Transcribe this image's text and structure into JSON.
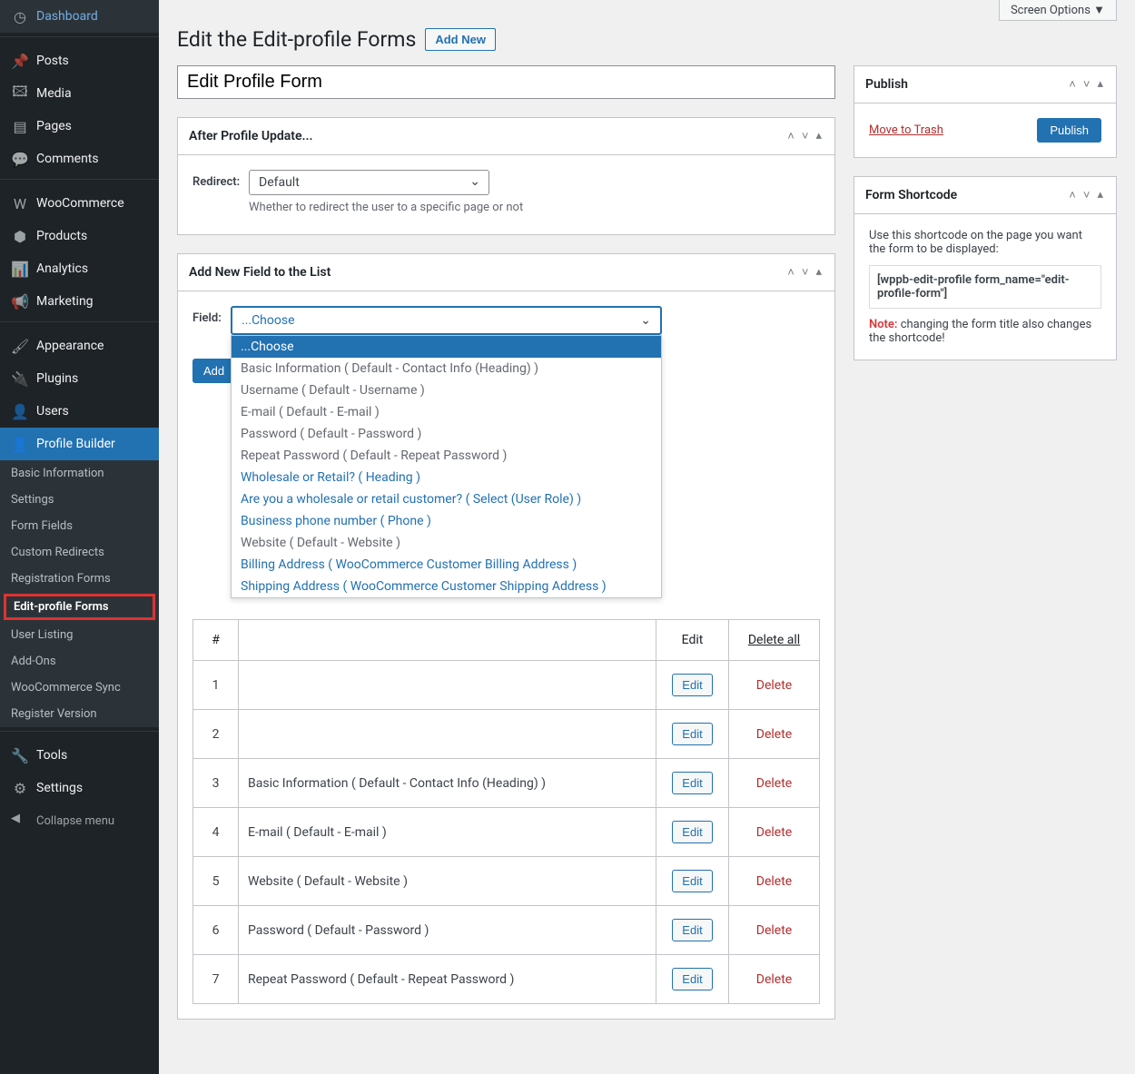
{
  "screen_options": "Screen Options ▼",
  "sidebar": {
    "items": [
      {
        "label": "Dashboard",
        "icon": "◷"
      },
      {
        "label": "Posts",
        "icon": "📌"
      },
      {
        "label": "Media",
        "icon": "🖾"
      },
      {
        "label": "Pages",
        "icon": "▤"
      },
      {
        "label": "Comments",
        "icon": "💬"
      },
      {
        "label": "WooCommerce",
        "icon": "W"
      },
      {
        "label": "Products",
        "icon": "⬢"
      },
      {
        "label": "Analytics",
        "icon": "📊"
      },
      {
        "label": "Marketing",
        "icon": "📢"
      },
      {
        "label": "Appearance",
        "icon": "🖌"
      },
      {
        "label": "Plugins",
        "icon": "🔌"
      },
      {
        "label": "Users",
        "icon": "👤"
      },
      {
        "label": "Profile Builder",
        "icon": "👤"
      },
      {
        "label": "Tools",
        "icon": "🔧"
      },
      {
        "label": "Settings",
        "icon": "⚙"
      }
    ],
    "submenu": [
      "Basic Information",
      "Settings",
      "Form Fields",
      "Custom Redirects",
      "Registration Forms",
      "Edit-profile Forms",
      "User Listing",
      "Add-Ons",
      "WooCommerce Sync",
      "Register Version"
    ],
    "collapse": "Collapse menu"
  },
  "header": {
    "title": "Edit the Edit-profile Forms",
    "add_new": "Add New"
  },
  "title_input": "Edit Profile Form",
  "metabox_after": {
    "title": "After Profile Update...",
    "label": "Redirect:",
    "value": "Default",
    "help": "Whether to redirect the user to a specific page or not"
  },
  "metabox_addfield": {
    "title": "Add New Field to the List",
    "label": "Field:",
    "selected": "...Choose",
    "options": [
      {
        "text": "...Choose",
        "hl": true
      },
      {
        "text": "Basic Information ( Default - Contact Info (Heading) )",
        "disabled": true
      },
      {
        "text": "Username ( Default - Username )",
        "disabled": true
      },
      {
        "text": "E-mail ( Default - E-mail )",
        "disabled": true
      },
      {
        "text": "Password ( Default - Password )",
        "disabled": true
      },
      {
        "text": "Repeat Password ( Default - Repeat Password )",
        "disabled": true
      },
      {
        "text": "Wholesale or Retail? ( Heading )"
      },
      {
        "text": "Are you a wholesale or retail customer? ( Select (User Role) )"
      },
      {
        "text": "Business phone number ( Phone )"
      },
      {
        "text": "Website ( Default - Website )",
        "disabled": true
      },
      {
        "text": "Billing Address ( WooCommerce Customer Billing Address )"
      },
      {
        "text": "Shipping Address ( WooCommerce Customer Shipping Address )"
      }
    ],
    "add_btn": "Add",
    "table": {
      "headers": [
        "#",
        "",
        "Edit",
        "Delete all"
      ],
      "rows": [
        {
          "n": "1",
          "name": "",
          "edit": "Edit",
          "del": "Delete"
        },
        {
          "n": "2",
          "name": "",
          "edit": "Edit",
          "del": "Delete"
        },
        {
          "n": "3",
          "name": "Basic Information ( Default - Contact Info (Heading) )",
          "edit": "Edit",
          "del": "Delete"
        },
        {
          "n": "4",
          "name": "E-mail ( Default - E-mail )",
          "edit": "Edit",
          "del": "Delete"
        },
        {
          "n": "5",
          "name": "Website ( Default - Website )",
          "edit": "Edit",
          "del": "Delete"
        },
        {
          "n": "6",
          "name": "Password ( Default - Password )",
          "edit": "Edit",
          "del": "Delete"
        },
        {
          "n": "7",
          "name": "Repeat Password ( Default - Repeat Password )",
          "edit": "Edit",
          "del": "Delete"
        }
      ]
    }
  },
  "publish": {
    "title": "Publish",
    "trash": "Move to Trash",
    "btn": "Publish"
  },
  "shortcode": {
    "title": "Form Shortcode",
    "desc": "Use this shortcode on the page you want the form to be displayed:",
    "code": "[wppb-edit-profile form_name=\"edit-profile-form\"]",
    "note_label": "Note:",
    "note": " changing the form title also changes the shortcode!"
  }
}
